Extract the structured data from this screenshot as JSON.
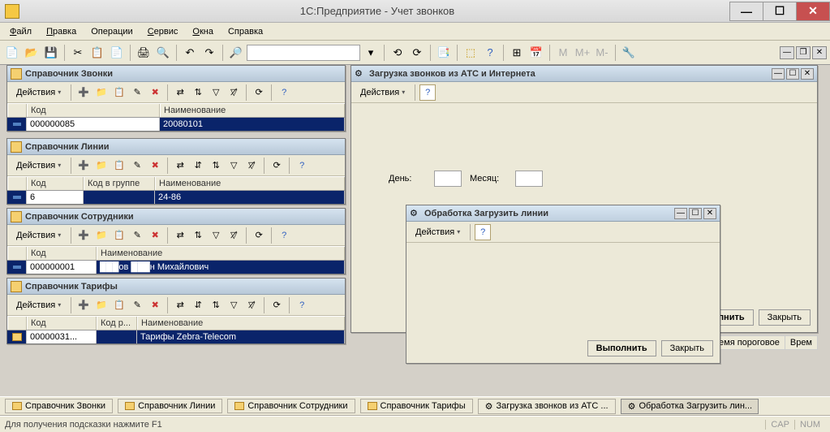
{
  "app": {
    "title": "1С:Предприятие - Учет звонков"
  },
  "menu": [
    "Файл",
    "Правка",
    "Операции",
    "Сервис",
    "Окна",
    "Справка"
  ],
  "actions_label": "Действия",
  "panels": {
    "calls": {
      "title": "Справочник Звонки",
      "cols": {
        "code": "Код",
        "name": "Наименование"
      },
      "row": {
        "code": "000000085",
        "name": "20080101"
      }
    },
    "lines": {
      "title": "Справочник Линии",
      "cols": {
        "code": "Код",
        "grp": "Код в группе",
        "name": "Наименование"
      },
      "row": {
        "code": "6",
        "grp": "",
        "name": "24-86"
      }
    },
    "employees": {
      "title": "Справочник Сотрудники",
      "cols": {
        "code": "Код",
        "name": "Наименование"
      },
      "row": {
        "code": "000000001",
        "name": "███ов ███н Михайлович"
      }
    },
    "tariffs": {
      "title": "Справочник Тарифы",
      "cols": {
        "code": "Код",
        "pcode": "Код р...",
        "name": "Наименование"
      },
      "row": {
        "code": "00000031...",
        "pcode": "",
        "name": "Тарифы Zebra-Telecom"
      }
    }
  },
  "load_window": {
    "title": "Загрузка звонков из АТС и Интернета",
    "day_label": "День:",
    "month_label": "Месяц:",
    "execute": "Выполнить",
    "close": "Закрыть",
    "extra_col": "время пороговое",
    "extra_col2": "Врем"
  },
  "load_lines": {
    "title": "Обработка  Загрузить линии",
    "execute": "Выполнить",
    "close": "Закрыть"
  },
  "taskbar": [
    "Справочник Звонки",
    "Справочник Линии",
    "Справочник Сотрудники",
    "Справочник Тарифы",
    "Загрузка звонков из АТС ...",
    "Обработка  Загрузить лин..."
  ],
  "status": {
    "hint": "Для получения подсказки нажмите F1",
    "cap": "CAP",
    "num": "NUM"
  }
}
